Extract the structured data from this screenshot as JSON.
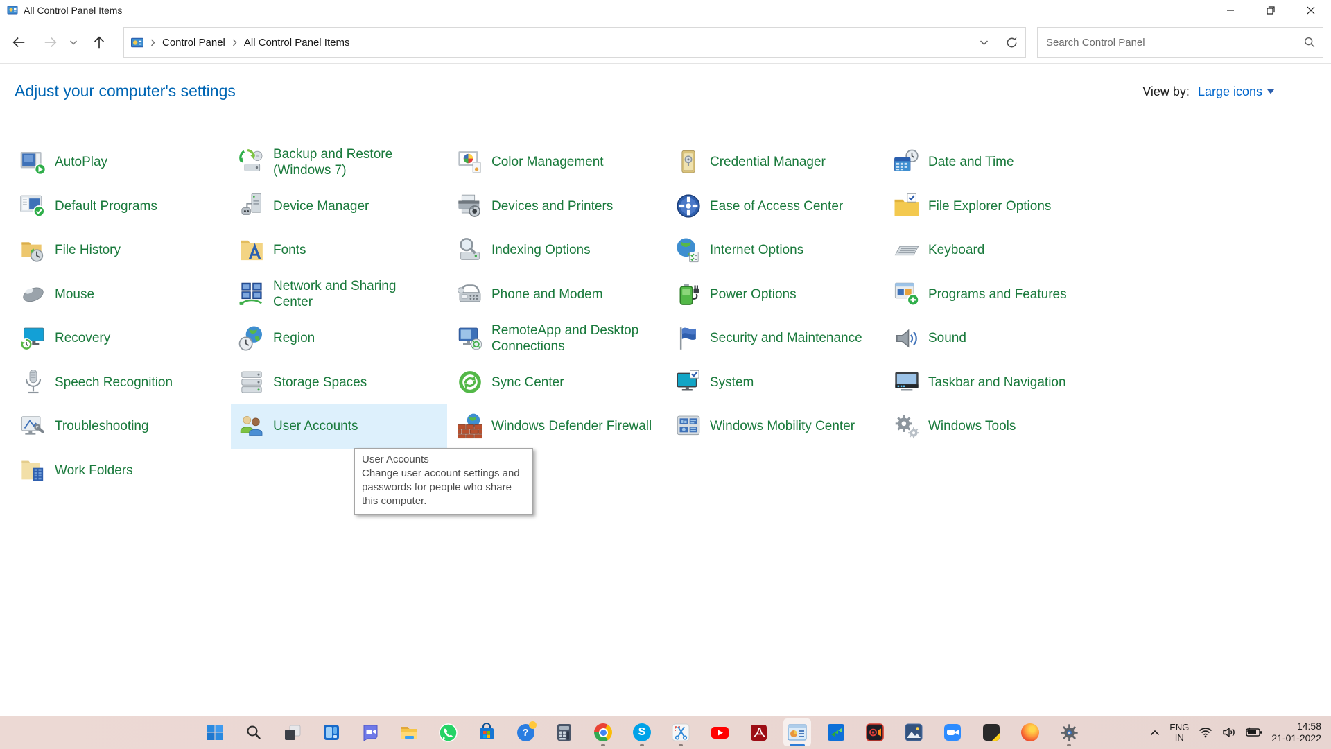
{
  "window": {
    "title": "All Control Panel Items"
  },
  "nav": {
    "breadcrumb": [
      "Control Panel",
      "All Control Panel Items"
    ],
    "search_placeholder": "Search Control Panel",
    "icons": [
      "back-icon",
      "forward-icon",
      "recent-locations-icon",
      "up-icon",
      "address-icon",
      "address-dropdown-icon",
      "refresh-icon",
      "search-icon"
    ]
  },
  "header": {
    "title": "Adjust your computer's settings",
    "view_by_label": "View by:",
    "view_by_value": "Large icons"
  },
  "grid": {
    "columns": [
      {
        "items": [
          {
            "label": "AutoPlay",
            "icon": "autoplay-icon"
          },
          {
            "label": "Default Programs",
            "icon": "default-programs-icon"
          },
          {
            "label": "File History",
            "icon": "file-history-icon"
          },
          {
            "label": "Mouse",
            "icon": "mouse-icon"
          },
          {
            "label": "Recovery",
            "icon": "recovery-icon"
          },
          {
            "label": "Speech Recognition",
            "icon": "speech-recognition-icon"
          },
          {
            "label": "Troubleshooting",
            "icon": "troubleshooting-icon"
          },
          {
            "label": "Work Folders",
            "icon": "work-folders-icon"
          }
        ]
      },
      {
        "items": [
          {
            "label": "Backup and Restore (Windows 7)",
            "icon": "backup-restore-icon"
          },
          {
            "label": "Device Manager",
            "icon": "device-manager-icon"
          },
          {
            "label": "Fonts",
            "icon": "fonts-icon"
          },
          {
            "label": "Network and Sharing Center",
            "icon": "network-sharing-icon"
          },
          {
            "label": "Region",
            "icon": "region-icon"
          },
          {
            "label": "Storage Spaces",
            "icon": "storage-spaces-icon"
          },
          {
            "label": "User Accounts",
            "icon": "user-accounts-icon",
            "state": "hovered"
          }
        ]
      },
      {
        "items": [
          {
            "label": "Color Management",
            "icon": "color-management-icon"
          },
          {
            "label": "Devices and Printers",
            "icon": "devices-printers-icon"
          },
          {
            "label": "Indexing Options",
            "icon": "indexing-options-icon"
          },
          {
            "label": "Phone and Modem",
            "icon": "phone-modem-icon"
          },
          {
            "label": "RemoteApp and Desktop Connections",
            "icon": "remoteapp-icon"
          },
          {
            "label": "Sync Center",
            "icon": "sync-center-icon"
          },
          {
            "label": "Windows Defender Firewall",
            "icon": "defender-firewall-icon"
          }
        ]
      },
      {
        "items": [
          {
            "label": "Credential Manager",
            "icon": "credential-manager-icon"
          },
          {
            "label": "Ease of Access Center",
            "icon": "ease-of-access-icon"
          },
          {
            "label": "Internet Options",
            "icon": "internet-options-icon"
          },
          {
            "label": "Power Options",
            "icon": "power-options-icon"
          },
          {
            "label": "Security and Maintenance",
            "icon": "security-maintenance-icon"
          },
          {
            "label": "System",
            "icon": "system-icon"
          },
          {
            "label": "Windows Mobility Center",
            "icon": "mobility-center-icon"
          }
        ]
      },
      {
        "items": [
          {
            "label": "Date and Time",
            "icon": "date-time-icon"
          },
          {
            "label": "File Explorer Options",
            "icon": "file-explorer-options-icon"
          },
          {
            "label": "Keyboard",
            "icon": "keyboard-icon"
          },
          {
            "label": "Programs and Features",
            "icon": "programs-features-icon"
          },
          {
            "label": "Sound",
            "icon": "sound-icon"
          },
          {
            "label": "Taskbar and Navigation",
            "icon": "taskbar-navigation-icon"
          },
          {
            "label": "Windows Tools",
            "icon": "windows-tools-icon"
          }
        ]
      }
    ]
  },
  "tooltip": {
    "title": "User Accounts",
    "body": "Change user account settings and passwords for people who share this computer."
  },
  "taskbar": {
    "items": [
      "start",
      "search",
      "task-view",
      "widgets",
      "chat",
      "file-explorer",
      "whatsapp",
      "microsoft-store",
      "get-help",
      "calculator",
      "chrome",
      "skype",
      "snipping-tool",
      "youtube",
      "acrobat",
      "control-panel",
      "video-app",
      "screen-recorder",
      "photos",
      "zoom",
      "notes",
      "firefox",
      "settings"
    ],
    "running": [
      "chrome",
      "skype",
      "snipping-tool",
      "settings"
    ],
    "active": "control-panel",
    "tray": {
      "lang1": "ENG",
      "lang2": "IN",
      "time": "14:58",
      "date": "21-01-2022"
    }
  },
  "colors": {
    "item_link_green": "#1a7a3c",
    "header_blue": "#0066b4",
    "view_by_blue": "#0066cc",
    "hover_highlight": "#ddf0fc",
    "taskbar_bg": "#ead7d2"
  }
}
